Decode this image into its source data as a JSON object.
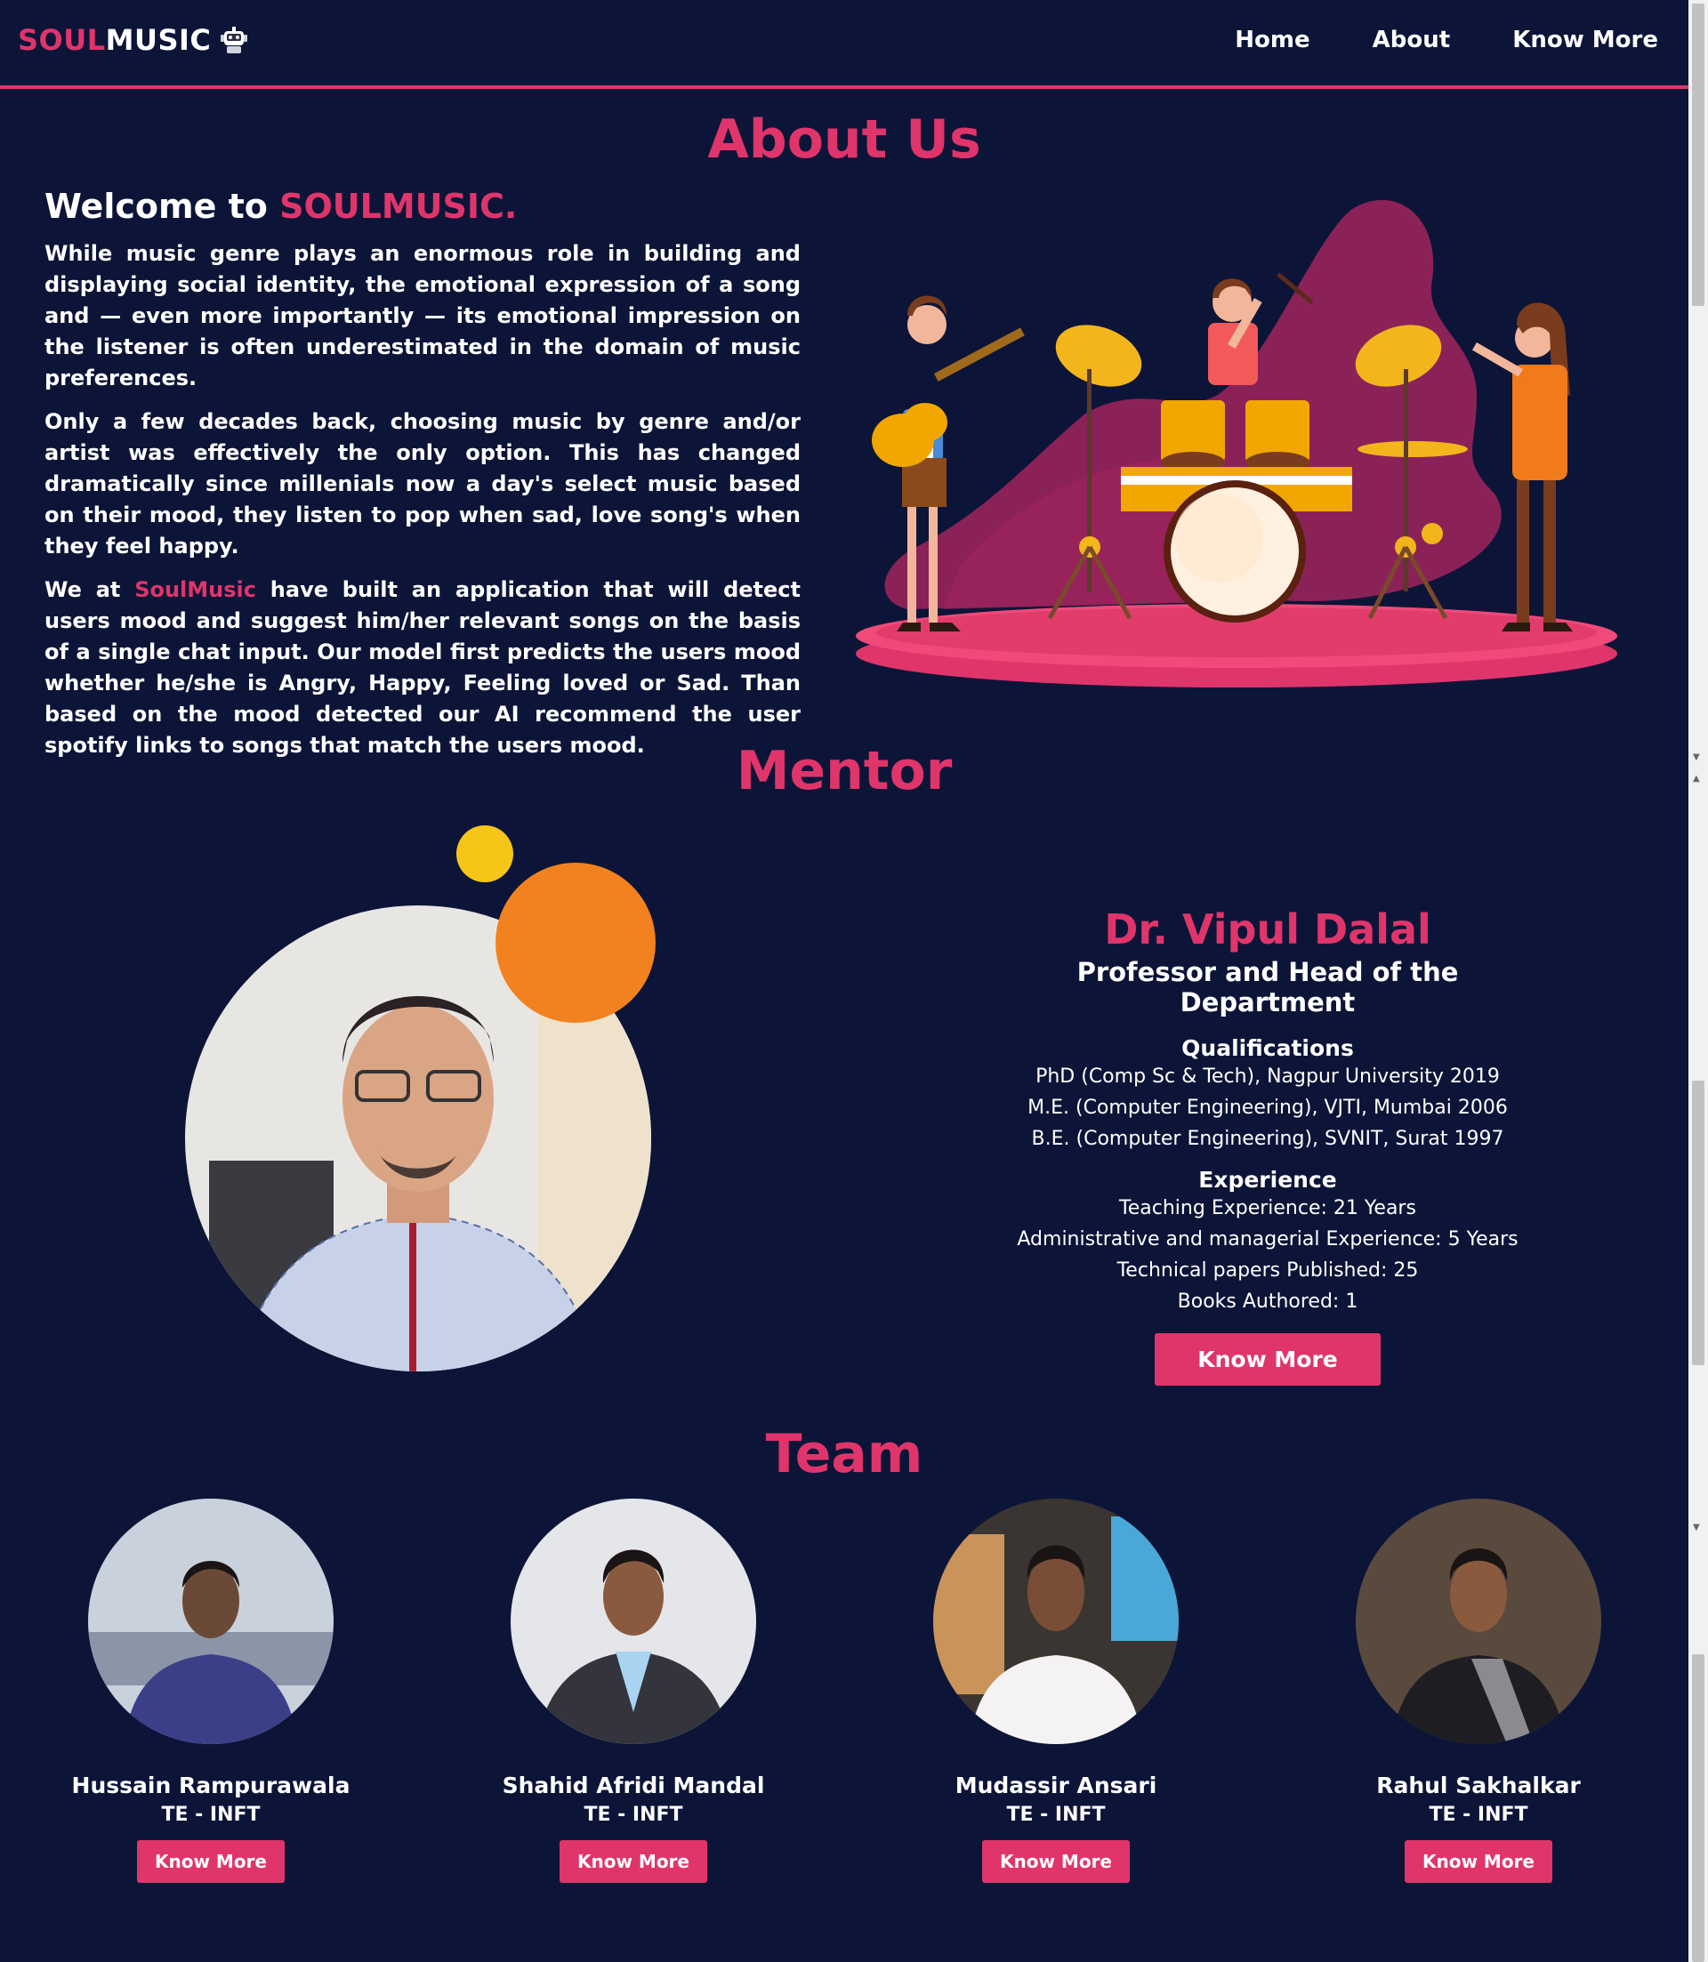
{
  "nav": {
    "brand_soul": "SOUL",
    "brand_music": "MUSIC",
    "links": [
      "Home",
      "About",
      "Know More"
    ]
  },
  "about": {
    "title": "About Us",
    "welcome_prefix": "Welcome to ",
    "welcome_brand": "SOULMUSIC.",
    "para1": "While music genre plays an enormous role in building and displaying social identity, the emotional expression of a song and — even more importantly — its emotional impression on the listener is often underestimated in the domain of music preferences.",
    "para2": "Only a few decades back, choosing music by genre and/or artist was effectively the only option. This has changed dramatically since millenials now a day's select music based on their mood, they listen to pop when sad, love song's when they feel happy.",
    "para3_prefix": "We at ",
    "para3_brand": "SoulMusic",
    "para3_rest": " have built an application that will detect users mood and suggest him/her relevant songs on the basis of a single chat input. Our model first predicts the users mood whether he/she is Angry, Happy, Feeling loved or Sad. Than based on the mood detected our AI recommend the user spotify links to songs that match the users mood."
  },
  "mentor": {
    "title": "Mentor",
    "name": "Dr. Vipul Dalal",
    "role": "Professor and Head of the Department",
    "qualifications_heading": "Qualifications",
    "qualifications": [
      "PhD (Comp Sc & Tech), Nagpur University 2019",
      "M.E. (Computer Engineering), VJTI, Mumbai 2006",
      "B.E. (Computer Engineering), SVNIT, Surat 1997"
    ],
    "experience_heading": "Experience",
    "experience": [
      "Teaching Experience: 21 Years",
      "Administrative and managerial Experience: 5 Years",
      "Technical papers Published: 25",
      "Books Authored: 1"
    ],
    "button": "Know More"
  },
  "team": {
    "title": "Team",
    "members": [
      {
        "name": "Hussain Rampurawala",
        "role": "TE - INFT",
        "button": "Know More"
      },
      {
        "name": "Shahid Afridi Mandal",
        "role": "TE - INFT",
        "button": "Know More"
      },
      {
        "name": "Mudassir Ansari",
        "role": "TE - INFT",
        "button": "Know More"
      },
      {
        "name": "Rahul Sakhalkar",
        "role": "TE - INFT",
        "button": "Know More"
      }
    ]
  },
  "colors": {
    "background": "#0c1538",
    "accent": "#e0356b",
    "text": "#ffffff"
  }
}
